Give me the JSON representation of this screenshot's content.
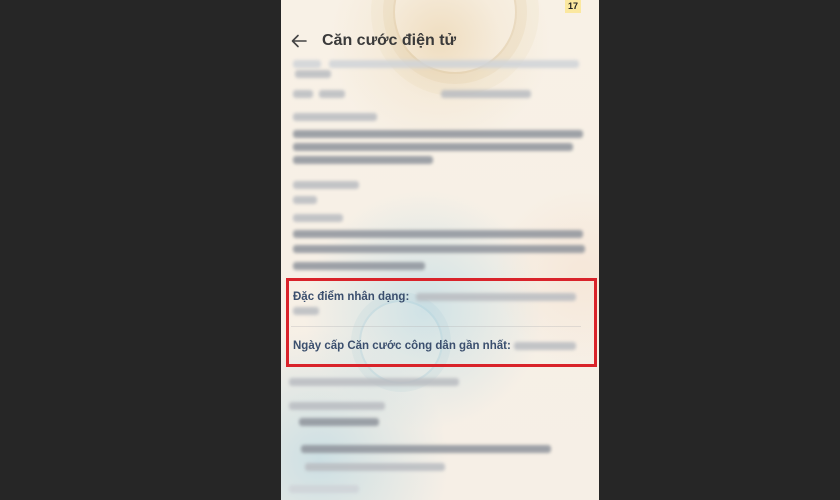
{
  "status": {
    "badge": "17"
  },
  "header": {
    "title": "Căn cước điện tử",
    "back_icon": "arrow-left-icon"
  },
  "highlighted_fields": [
    {
      "label": "Đặc điểm nhân dạng:"
    },
    {
      "label": "Ngày cấp Căn cước công dân gần nhất:"
    }
  ],
  "colors": {
    "highlight_border": "#d9232a",
    "label": "#3b4f6e",
    "background": "#262626"
  }
}
